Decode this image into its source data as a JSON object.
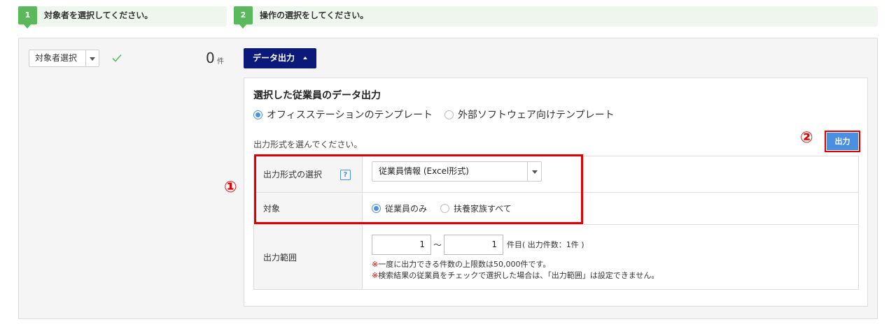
{
  "steps": [
    {
      "num": "1",
      "label": "対象者を選択してください。"
    },
    {
      "num": "2",
      "label": "操作の選択をしてください。"
    }
  ],
  "left": {
    "select_label": "対象者選択",
    "count": "0",
    "count_unit": "件"
  },
  "right": {
    "data_button": "データ出力",
    "section_title": "選択した従業員のデータ出力",
    "template_options": [
      "オフィスステーションのテンプレート",
      "外部ソフトウェア向けテンプレート"
    ],
    "template_selected_index": 0,
    "prompt": "出力形式を選んでください。",
    "output_button": "出力",
    "form": {
      "format_label": "出力形式の選択",
      "help": "?",
      "format_value": "従業員情報 (Excel形式)",
      "target_label": "対象",
      "target_options": [
        "従業員のみ",
        "扶養家族すべて"
      ],
      "target_selected_index": 0,
      "range_label": "出力範囲",
      "range_from": "1",
      "range_sep": "〜",
      "range_to": "1",
      "range_suffix": "件目( 出力件数：1件 )",
      "note_mark": "※",
      "note1": "一度に出力できる件数の上限数は50,000件です。",
      "note2": "検索結果の従業員をチェックで選択した場合は、「出力範囲」は設定できません。"
    }
  },
  "annotations": {
    "marker1": "①",
    "marker2": "②"
  },
  "colors": {
    "step_green": "#5cb85c",
    "primary_navy": "#0b1a7a",
    "button_blue": "#4a90e2",
    "highlight_red": "#e00000"
  }
}
